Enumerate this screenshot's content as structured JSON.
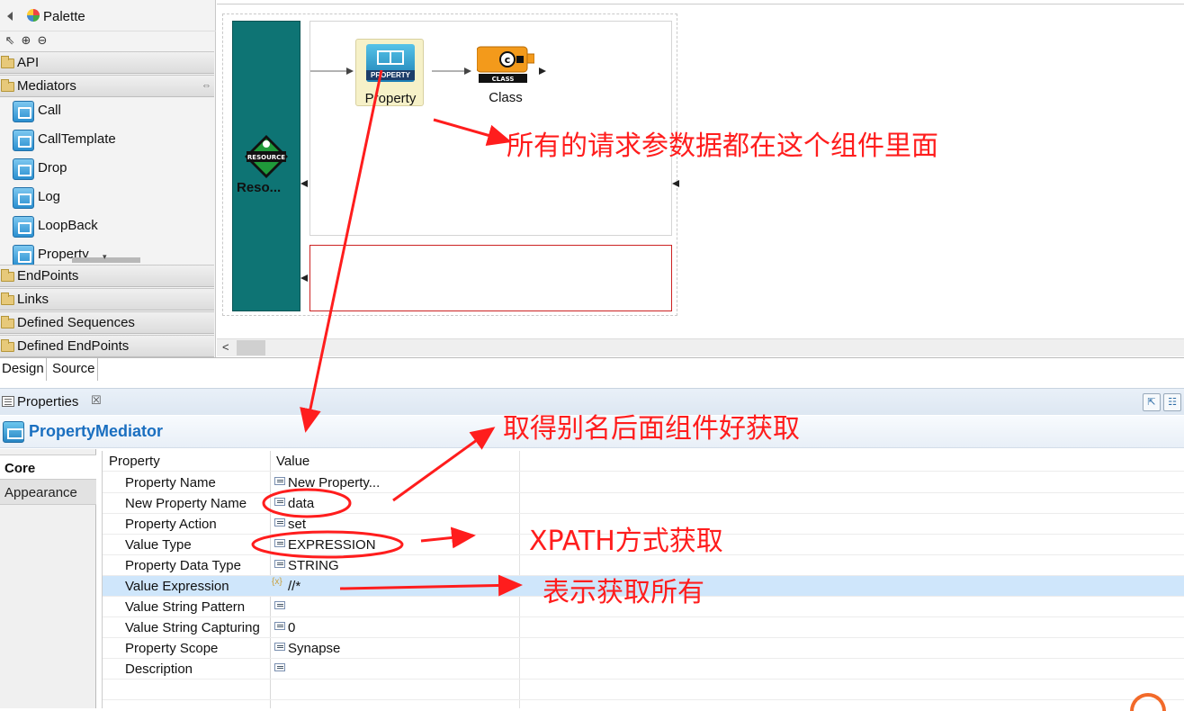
{
  "palette": {
    "title": "Palette",
    "drawers": {
      "api": "API",
      "mediators": "Mediators",
      "endpoints": "EndPoints",
      "links": "Links",
      "defined_sequences": "Defined Sequences",
      "defined_endpoints": "Defined EndPoints"
    },
    "mediator_items": [
      "Call",
      "CallTemplate",
      "Drop",
      "Log",
      "LoopBack",
      "Property"
    ]
  },
  "canvas": {
    "resource_label": "Reso...",
    "resource_tag": "RESOURCE",
    "property_node_label": "Property",
    "property_node_tag": "PROPERTY",
    "class_node_label": "Class",
    "class_node_tag": "CLASS"
  },
  "editor_tabs": {
    "design": "Design",
    "source": "Source"
  },
  "properties_view": {
    "title": "Properties",
    "close_glyph": "☒",
    "mediator_title": "PropertyMediator",
    "side_tabs": {
      "core": "Core",
      "appearance": "Appearance"
    },
    "table": {
      "header_property": "Property",
      "header_value": "Value",
      "rows": [
        {
          "key": "Property Name",
          "value": "New Property..."
        },
        {
          "key": "New Property Name",
          "value": "data"
        },
        {
          "key": "Property Action",
          "value": "set"
        },
        {
          "key": "Value Type",
          "value": "EXPRESSION"
        },
        {
          "key": "Property Data Type",
          "value": "STRING"
        },
        {
          "key": "Value Expression",
          "value": "//*"
        },
        {
          "key": "Value String Pattern",
          "value": ""
        },
        {
          "key": "Value String Capturing",
          "value": "0"
        },
        {
          "key": "Property Scope",
          "value": "Synapse"
        },
        {
          "key": "Description",
          "value": ""
        }
      ]
    }
  },
  "annotations": {
    "note1": "所有的请求参数据都在这个组件里面",
    "note2": "取得别名后面组件好获取",
    "note3": "XPATH方式获取",
    "note4": "表示获取所有",
    "color": "#ff1d1d"
  },
  "colors": {
    "api_bar": "#0e7474",
    "selection": "#cfe6fb",
    "mediator_title": "#1a6fc0",
    "fault_border": "#cc2222"
  }
}
